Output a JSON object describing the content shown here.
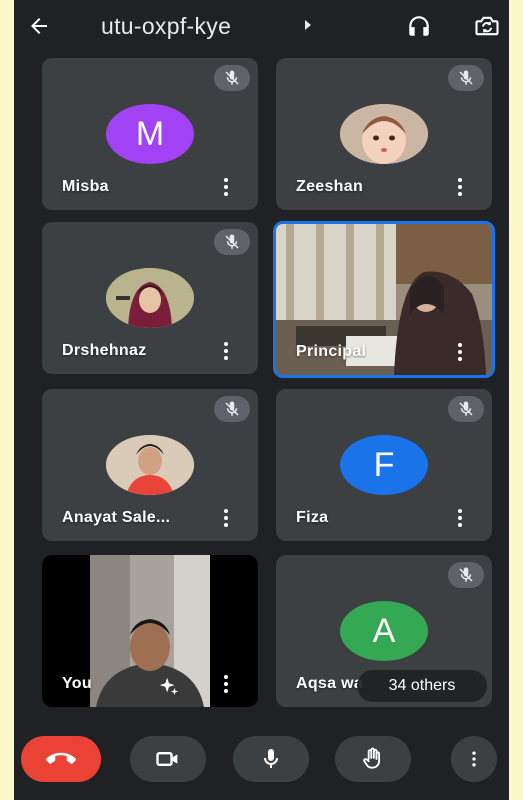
{
  "meeting": {
    "code": "utu-oxpf-kye"
  },
  "participants": [
    {
      "name": "Misba",
      "avatar_letter": "M",
      "avatar_color": "#a142f4"
    },
    {
      "name": "Zeeshan"
    },
    {
      "name": "Drshehnaz"
    },
    {
      "name": "Principal"
    },
    {
      "name": "Anayat Sale..."
    },
    {
      "name": "Fiza",
      "avatar_letter": "F",
      "avatar_color": "#1a73e8"
    },
    {
      "name": "You"
    },
    {
      "name": "Aqsa wa",
      "avatar_letter": "A",
      "avatar_color": "#34a853"
    }
  ],
  "others_label": "34 others",
  "icons": {
    "back": "arrow-left-icon",
    "audio": "headphones-icon",
    "switch_camera": "switch-camera-icon",
    "mute": "mic-off-icon",
    "more": "more-vert-icon",
    "effects": "sparkle-icon",
    "end_call": "call-end-icon",
    "camera": "videocam-icon",
    "mic": "mic-icon",
    "hand": "raise-hand-icon",
    "menu": "more-vert-icon"
  },
  "colors": {
    "background": "#202124",
    "tile": "#3c4043",
    "end_call": "#ea4335",
    "active_border": "#1a73e8",
    "frame": "#fcf8c8"
  }
}
